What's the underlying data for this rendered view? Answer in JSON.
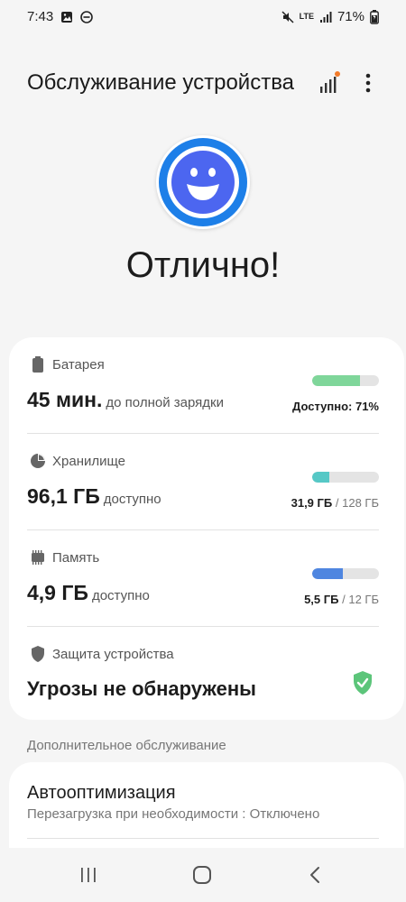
{
  "status_bar": {
    "time": "7:43",
    "network": "LTE",
    "battery": "71%"
  },
  "header": {
    "title": "Обслуживание устройства"
  },
  "summary": {
    "status_text": "Отлично!"
  },
  "items": {
    "battery": {
      "label": "Батарея",
      "value": "45 мин.",
      "value_sub": "до полной зарядки",
      "note": "Доступно: 71%",
      "level": 0.71
    },
    "storage": {
      "label": "Хранилище",
      "value": "96,1 ГБ",
      "value_sub": "доступно",
      "used": "31,9 ГБ",
      "total": "128 ГБ",
      "level": 0.25
    },
    "memory": {
      "label": "Память",
      "value": "4,9 ГБ",
      "value_sub": "доступно",
      "used": "5,5 ГБ",
      "total": "12 ГБ",
      "level": 0.46
    },
    "security": {
      "label": "Защита устройства",
      "value": "Угрозы не обнаружены"
    }
  },
  "additional": {
    "header": "Дополнительное обслуживание",
    "auto_opt": {
      "title": "Автооптимизация",
      "subtitle": "Перезагрузка при необходимости : Отключено"
    }
  },
  "separators": {
    "slash": "/"
  },
  "colors": {
    "battery_bar": "#7fd69a",
    "storage_bar": "#56c8c6",
    "memory_bar": "#4f86e0",
    "face_ring": "#1d7fe8",
    "face_inner": "#4c66f0",
    "shield_ok": "#5cc57a"
  },
  "icons": {
    "status_left": [
      "image-icon",
      "dnd-icon"
    ],
    "status_right": [
      "mute-icon",
      "signal-icon",
      "battery-charging-icon"
    ],
    "header": [
      "signal-bars-icon",
      "more-vert-icon"
    ],
    "nav": [
      "recent-apps-icon",
      "home-icon",
      "back-icon"
    ]
  }
}
